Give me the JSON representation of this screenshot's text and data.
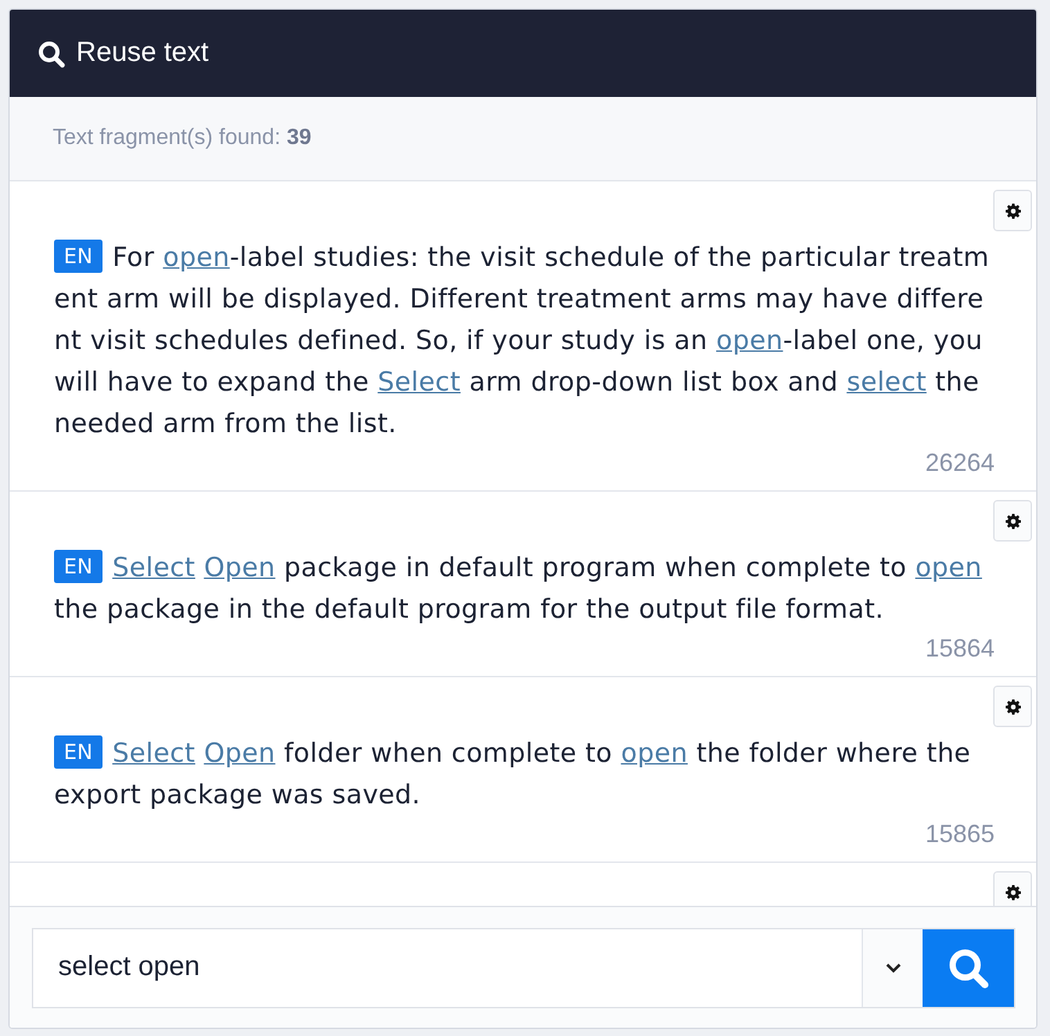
{
  "header": {
    "title": "Reuse text"
  },
  "summary": {
    "label": "Text fragment(s) found:",
    "count": "39"
  },
  "results": [
    {
      "kind": "fragment",
      "language": "EN",
      "id": "26264",
      "segments": [
        {
          "kind": "plain",
          "text": "For "
        },
        {
          "kind": "link",
          "text": "open"
        },
        {
          "kind": "plain",
          "text": "-label studies: the visit schedule of the particular treatment arm will be displayed. Different treatment arms may have different visit schedules defined. So, if your study is an "
        },
        {
          "kind": "link",
          "text": "open"
        },
        {
          "kind": "plain",
          "text": "-label one, you will have to expand the "
        },
        {
          "kind": "link",
          "text": "Select"
        },
        {
          "kind": "plain",
          "text": " arm drop-down list box and "
        },
        {
          "kind": "link",
          "text": "select"
        },
        {
          "kind": "plain",
          "text": " the needed arm from the list."
        }
      ]
    },
    {
      "kind": "fragment",
      "language": "EN",
      "id": "15864",
      "segments": [
        {
          "kind": "link",
          "text": "Select "
        },
        {
          "kind": "link",
          "text": "Open"
        },
        {
          "kind": "plain",
          "text": " package in default program when complete to "
        },
        {
          "kind": "link",
          "text": "open"
        },
        {
          "kind": "plain",
          "text": " the package in the default program for the output file format."
        }
      ]
    },
    {
      "kind": "fragment",
      "language": "EN",
      "id": "15865",
      "segments": [
        {
          "kind": "link",
          "text": "Select "
        },
        {
          "kind": "link",
          "text": "Open"
        },
        {
          "kind": "plain",
          "text": " folder when complete to "
        },
        {
          "kind": "link",
          "text": "open"
        },
        {
          "kind": "plain",
          "text": " the folder where the export package was saved."
        }
      ]
    },
    {
      "kind": "cut"
    }
  ],
  "search": {
    "value": "select open"
  }
}
